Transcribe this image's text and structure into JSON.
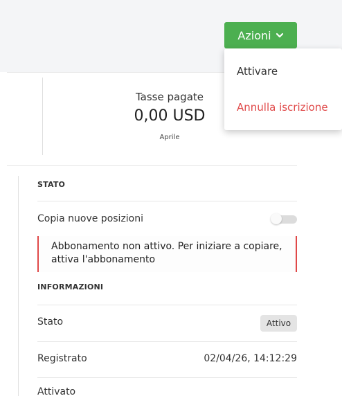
{
  "toolbar": {
    "actions_label": "Azioni",
    "accent_color": "#4caf50"
  },
  "dropdown": {
    "items": [
      {
        "label": "Attivare",
        "color": "#333333"
      },
      {
        "label": "Annulla iscrizione",
        "color": "#e04848"
      }
    ]
  },
  "stats": {
    "label": "Tasse pagate",
    "value": "0,00 USD",
    "sub": "Aprile"
  },
  "status_section": {
    "title": "STATO",
    "copy_label": "Copia nuove posizioni",
    "copy_enabled": false,
    "alert_text": "Abbonamento non attivo. Per iniziare a copiare, attiva l'abbonamento",
    "alert_color": "#e04848"
  },
  "info_section": {
    "title": "INFORMAZIONI",
    "rows": [
      {
        "label": "Stato",
        "badge": "Attivo"
      },
      {
        "label": "Registrato",
        "value": "02/04/26, 14:12:29"
      },
      {
        "label": "Attivato",
        "value": ""
      }
    ]
  }
}
